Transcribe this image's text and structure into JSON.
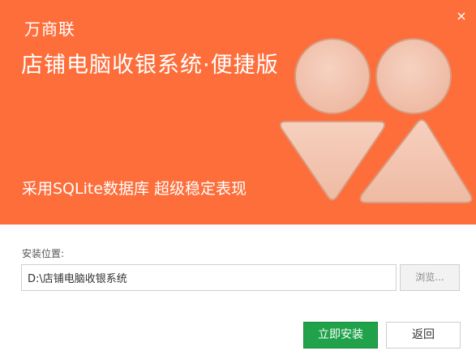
{
  "header": {
    "brand": "万商联",
    "product_title": "店铺电脑收银系统·便捷版",
    "tagline": "采用SQLite数据库 超级稳定表现",
    "close_symbol": "×"
  },
  "install": {
    "path_label": "安装位置:",
    "path_value": "D:\\店铺电脑收银系统",
    "browse_label": "浏览..."
  },
  "actions": {
    "install_label": "立即安装",
    "back_label": "返回"
  },
  "colors": {
    "banner": "#fd6e3b",
    "install_button": "#1fa24a",
    "logo_fill": "#f4c8b3"
  },
  "icons": {
    "logo": "wanshanglian-logo",
    "close": "close-icon"
  }
}
